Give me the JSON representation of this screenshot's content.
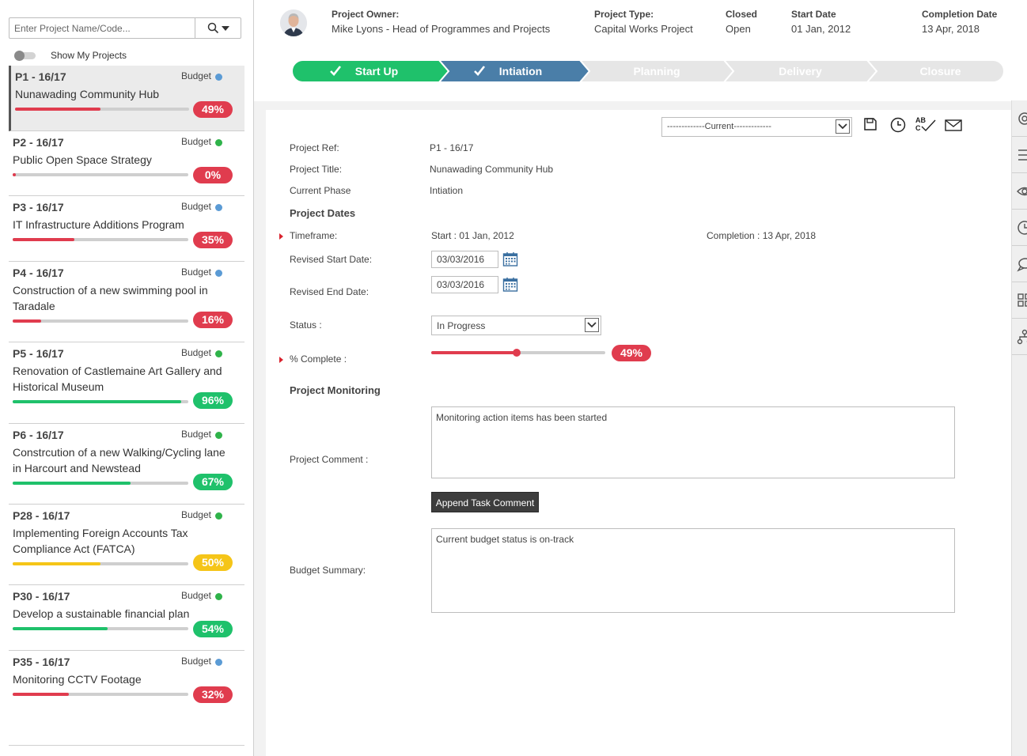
{
  "sidebar": {
    "search_placeholder": "Enter Project Name/Code...",
    "toggle_label": "Show My Projects",
    "projects": [
      {
        "code": "P1 - 16/17",
        "budget": "Budget",
        "status_color": "#5b9bd5",
        "title": "Nunawading Community Hub",
        "progress": 49,
        "pct_label": "49%",
        "color": "#e03c4e",
        "active": true
      },
      {
        "code": "P2 - 16/17",
        "budget": "Budget",
        "status_color": "#2fb34a",
        "title": "Public Open Space Strategy",
        "progress": 0,
        "pct_label": "0%",
        "color": "#e03c4e",
        "active": false
      },
      {
        "code": "P3 - 16/17",
        "budget": "Budget",
        "status_color": "#5b9bd5",
        "title": "IT Infrastructure Additions Program",
        "progress": 35,
        "pct_label": "35%",
        "color": "#e03c4e",
        "active": false
      },
      {
        "code": "P4 - 16/17",
        "budget": "Budget",
        "status_color": "#5b9bd5",
        "title": "Construction of a new swimming pool in Taradale",
        "progress": 16,
        "pct_label": "16%",
        "color": "#e03c4e",
        "active": false
      },
      {
        "code": "P5 - 16/17",
        "budget": "Budget",
        "status_color": "#2fb34a",
        "title": "Renovation of Castlemaine Art Gallery and Historical Museum",
        "progress": 96,
        "pct_label": "96%",
        "color": "#1fc16b",
        "active": false
      },
      {
        "code": "P6 - 16/17",
        "budget": "Budget",
        "status_color": "#2fb34a",
        "title": "Constrcution of a new Walking/Cycling lane in Harcourt and Newstead",
        "progress": 67,
        "pct_label": "67%",
        "color": "#1fc16b",
        "active": false
      },
      {
        "code": "P28 - 16/17",
        "budget": "Budget",
        "status_color": "#2fb34a",
        "title": "Implementing Foreign Accounts Tax Compliance Act (FATCA)",
        "progress": 50,
        "pct_label": "50%",
        "color": "#f5c518",
        "active": false
      },
      {
        "code": "P30 - 16/17",
        "budget": "Budget",
        "status_color": "#2fb34a",
        "title": "Develop a sustainable financial plan",
        "progress": 54,
        "pct_label": "54%",
        "color": "#1fc16b",
        "active": false
      },
      {
        "code": "P35 - 16/17",
        "budget": "Budget",
        "status_color": "#5b9bd5",
        "title": "Monitoring CCTV Footage",
        "progress": 32,
        "pct_label": "32%",
        "color": "#e03c4e",
        "active": false
      }
    ]
  },
  "header": {
    "owner_label": "Project Owner:",
    "owner_value": "Mike Lyons - Head of Programmes and Projects",
    "type_label": "Project Type:",
    "type_value": "Capital Works Project",
    "closed_label": "Closed",
    "closed_value": "Open",
    "start_label": "Start Date",
    "start_value": "01 Jan, 2012",
    "completion_label": "Completion Date",
    "completion_value": "13 Apr, 2018"
  },
  "phases": [
    {
      "label": "Start Up",
      "state": "done",
      "color": "#1fc16b"
    },
    {
      "label": "Intiation",
      "state": "current",
      "color": "#4a7ea8"
    },
    {
      "label": "Planning",
      "state": "pending",
      "color": "#e6e6e6"
    },
    {
      "label": "Delivery",
      "state": "pending",
      "color": "#e6e6e6"
    },
    {
      "label": "Closure",
      "state": "pending",
      "color": "#e6e6e6"
    }
  ],
  "form": {
    "version_select": "-------------Current-------------",
    "ref_label": "Project Ref:",
    "ref_value": "P1 - 16/17",
    "title_label": "Project Title:",
    "title_value": "Nunawading Community Hub",
    "phase_label": "Current Phase",
    "phase_value": "Intiation",
    "dates_section": "Project Dates",
    "timeframe_label": "Timeframe:",
    "timeframe_start": "Start : 01 Jan, 2012",
    "timeframe_completion": "Completion : 13 Apr, 2018",
    "revised_start_label": "Revised Start Date:",
    "revised_start_value": "03/03/2016",
    "revised_end_label": "Revised End Date:",
    "revised_end_value": "03/03/2016",
    "status_label": "Status :",
    "status_value": "In Progress",
    "complete_label": "% Complete :",
    "complete_value": 49,
    "complete_pct_label": "49%",
    "monitoring_section": "Project Monitoring",
    "comment_label": "Project Comment :",
    "comment_value": "Monitoring action items has been started",
    "append_button": "Append Task Comment",
    "budget_label": "Budget Summary:",
    "budget_value": "Current budget status is on-track"
  },
  "toolbar": {
    "save_icon": "save-icon",
    "history_icon": "clock-icon",
    "spellcheck_text": "AB C",
    "email_icon": "envelope-icon"
  },
  "colors": {
    "red": "#e03c4e",
    "green": "#1fc16b",
    "blue": "#4a7ea8",
    "yellow": "#f5c518"
  }
}
